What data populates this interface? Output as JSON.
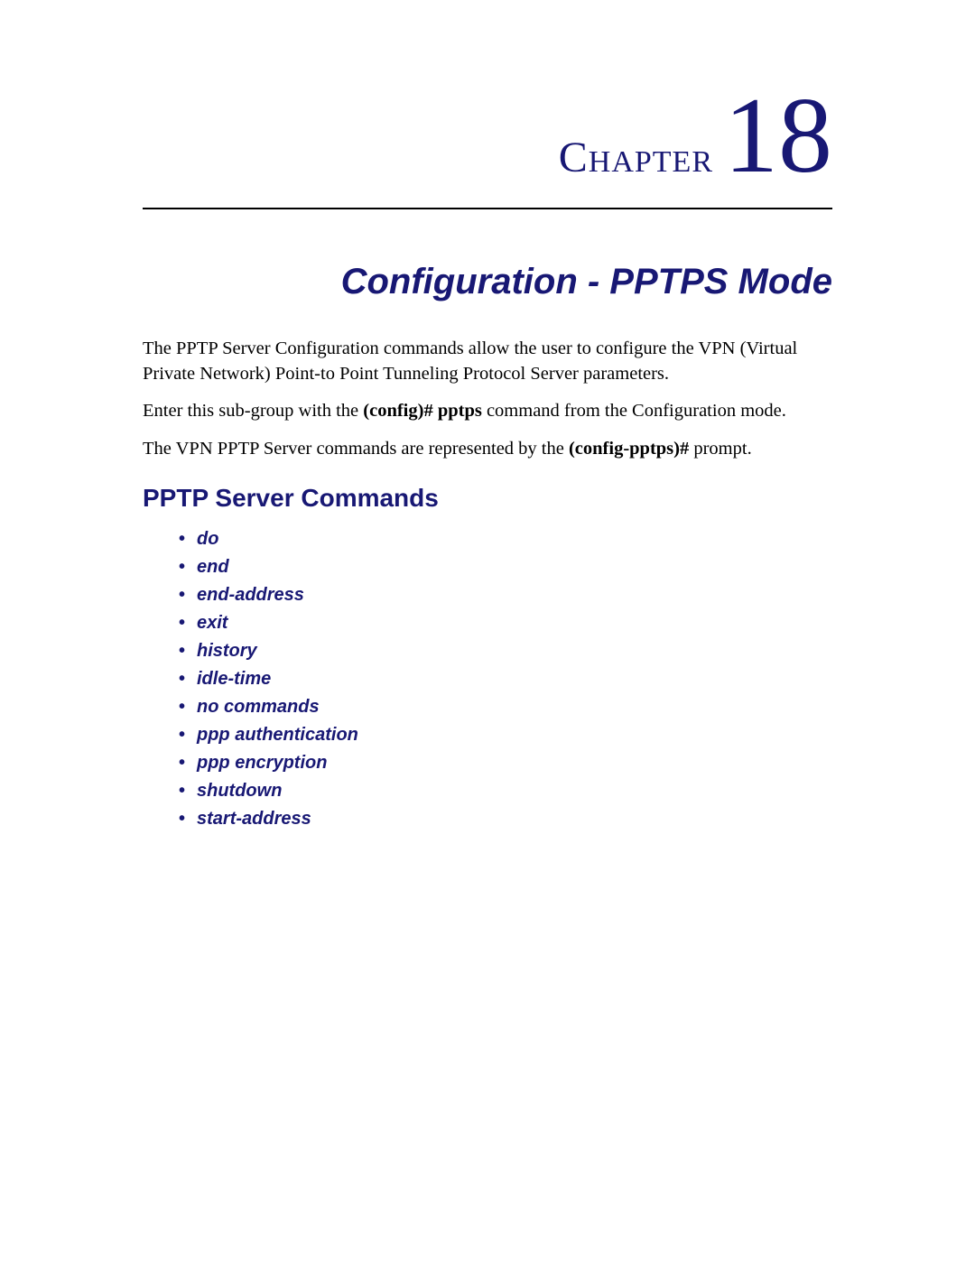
{
  "chapter": {
    "label": "Chapter",
    "number": "18"
  },
  "title": "Configuration - PPTPS Mode",
  "paragraphs": {
    "p1": "The PPTP Server Configuration commands allow the user to configure the VPN (Virtual Private Network) Point-to Point Tunneling Protocol Server parameters.",
    "p2_pre": "Enter this sub-group with the ",
    "p2_bold": "(config)# pptps",
    "p2_post": " command from the Configuration mode.",
    "p3_pre": "The VPN PPTP Server commands are represented by the ",
    "p3_bold": "(config-pptps)#",
    "p3_post": " prompt."
  },
  "section_heading": "PPTP Server Commands",
  "commands": [
    "do",
    "end",
    "end-address",
    "exit",
    "history",
    "idle-time",
    "no commands",
    "ppp authentication",
    "ppp encryption",
    "shutdown",
    "start-address"
  ]
}
